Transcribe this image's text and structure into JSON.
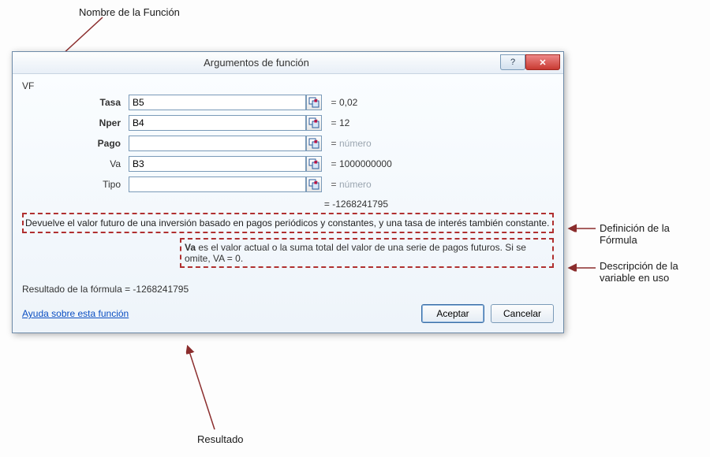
{
  "annotations": {
    "top": "Nombre de la Función",
    "right1": "Definición de la Fórmula",
    "right2": "Descripción de la variable en uso",
    "bottom": "Resultado"
  },
  "dialog": {
    "title": "Argumentos de función",
    "fn_name": "VF",
    "args": [
      {
        "label": "Tasa",
        "bold": true,
        "value": "B5",
        "result": "0,02",
        "placeholder": false
      },
      {
        "label": "Nper",
        "bold": true,
        "value": "B4",
        "result": "12",
        "placeholder": false
      },
      {
        "label": "Pago",
        "bold": true,
        "value": "",
        "result": "número",
        "placeholder": true
      },
      {
        "label": "Va",
        "bold": false,
        "value": "B3",
        "result": "1000000000",
        "placeholder": false
      },
      {
        "label": "Tipo",
        "bold": false,
        "value": "",
        "result": "número",
        "placeholder": true
      }
    ],
    "preview_prefix": "=  ",
    "preview_value": "-1268241795",
    "description": "Devuelve el valor futuro de una inversión basado en pagos periódicos y constantes, y una tasa de interés también constante.",
    "arg_desc_name": "Va",
    "arg_desc_text": "  es el valor actual o la suma total del valor de una serie de pagos futuros. Si se omite, VA = 0.",
    "result_label": "Resultado de la fórmula =   ",
    "result_value": "-1268241795",
    "help_link": "Ayuda sobre esta función",
    "ok": "Aceptar",
    "cancel": "Cancelar"
  }
}
